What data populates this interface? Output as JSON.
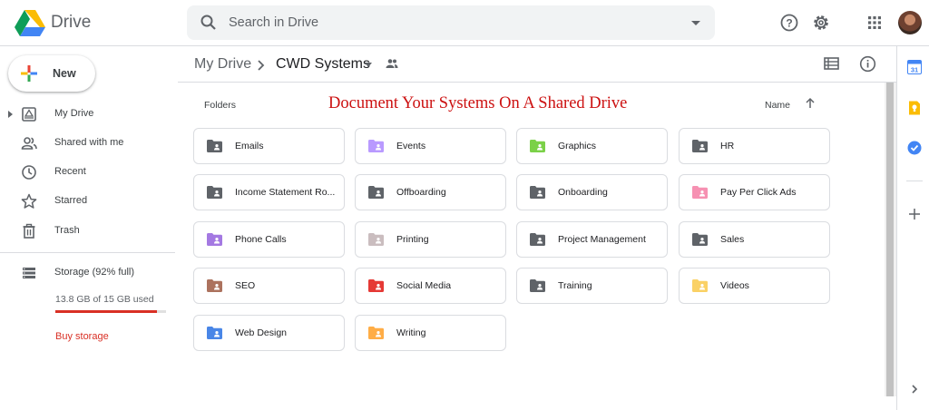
{
  "app": {
    "title": "Drive"
  },
  "search": {
    "placeholder": "Search in Drive"
  },
  "sidebar": {
    "new_label": "New",
    "items": [
      {
        "label": "My Drive",
        "icon": "my-drive-icon"
      },
      {
        "label": "Shared with me",
        "icon": "shared-people-icon"
      },
      {
        "label": "Recent",
        "icon": "clock-icon"
      },
      {
        "label": "Starred",
        "icon": "star-icon"
      },
      {
        "label": "Trash",
        "icon": "trash-icon"
      }
    ],
    "storage": {
      "label": "Storage (92% full)",
      "used_text": "13.8 GB of 15 GB used",
      "fraction": 0.92,
      "buy_label": "Buy storage"
    }
  },
  "breadcrumb": {
    "root": "My Drive",
    "current": "CWD Systems"
  },
  "main": {
    "section_label": "Folders",
    "banner_text": "Document Your Systems On A Shared Drive",
    "sort_label": "Name"
  },
  "folders": [
    {
      "name": "Emails",
      "color": "#5f6368"
    },
    {
      "name": "Events",
      "color": "#b99aff"
    },
    {
      "name": "Graphics",
      "color": "#7bd148"
    },
    {
      "name": "HR",
      "color": "#5f6368"
    },
    {
      "name": "Income Statement Ro...",
      "color": "#5f6368"
    },
    {
      "name": "Offboarding",
      "color": "#5f6368"
    },
    {
      "name": "Onboarding",
      "color": "#5f6368"
    },
    {
      "name": "Pay Per Click Ads",
      "color": "#f691b2"
    },
    {
      "name": "Phone Calls",
      "color": "#a479e2"
    },
    {
      "name": "Printing",
      "color": "#cabdbf"
    },
    {
      "name": "Project Management",
      "color": "#5f6368"
    },
    {
      "name": "Sales",
      "color": "#5f6368"
    },
    {
      "name": "SEO",
      "color": "#ac725e"
    },
    {
      "name": "Social Media",
      "color": "#e53935"
    },
    {
      "name": "Training",
      "color": "#5f6368"
    },
    {
      "name": "Videos",
      "color": "#fad165"
    },
    {
      "name": "Web Design",
      "color": "#4986e7"
    },
    {
      "name": "Writing",
      "color": "#ffad46"
    }
  ],
  "rail": {
    "calendar_label": "31"
  }
}
